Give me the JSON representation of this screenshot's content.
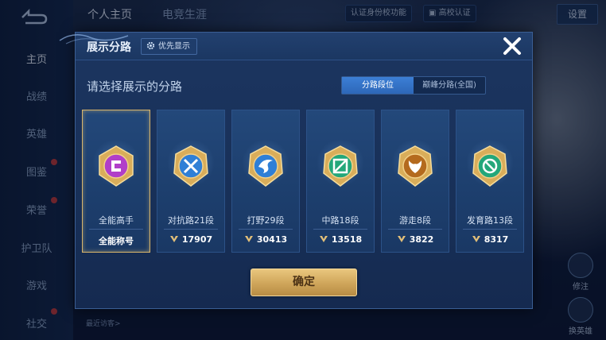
{
  "sidebar": {
    "items": [
      {
        "label": "主页",
        "active": true
      },
      {
        "label": "战绩"
      },
      {
        "label": "英雄"
      },
      {
        "label": "图鉴",
        "dot": true
      },
      {
        "label": "荣誉",
        "dot": true
      },
      {
        "label": "护卫队"
      },
      {
        "label": "游戏"
      },
      {
        "label": "社交",
        "dot": true
      }
    ]
  },
  "topbar": {
    "tabs": [
      {
        "label": "个人主页",
        "active": true
      },
      {
        "label": "电竞生涯"
      }
    ],
    "verify_label": "认证身份校功能",
    "campus_label": "高校认证",
    "settings_label": "设置"
  },
  "background": {
    "recent_visitors_label": "最近访客>",
    "right_buttons": [
      "修注",
      "换英雄"
    ]
  },
  "dialog": {
    "title": "展示分路",
    "priority_button": "优先显示",
    "subtitle": "请选择展示的分路",
    "segments": [
      {
        "label": "分路段位",
        "active": true
      },
      {
        "label": "巅峰分路(全国)",
        "active": false
      }
    ],
    "cards": [
      {
        "name": "全能高手",
        "stat": "全能称号",
        "badge": "all-round-badge-icon",
        "color": "#b13ec9",
        "selected": true
      },
      {
        "name": "对抗路21段",
        "stat": "17907",
        "badge": "clash-lane-badge-icon",
        "color": "#2f7fd6"
      },
      {
        "name": "打野29段",
        "stat": "30413",
        "badge": "jungle-badge-icon",
        "color": "#2f7fd6"
      },
      {
        "name": "中路18段",
        "stat": "13518",
        "badge": "mid-lane-badge-icon",
        "color": "#23a77a"
      },
      {
        "name": "游走8段",
        "stat": "3822",
        "badge": "roam-badge-icon",
        "color": "#b46a1e"
      },
      {
        "name": "发育路13段",
        "stat": "8317",
        "badge": "farm-lane-badge-icon",
        "color": "#23a77a"
      }
    ],
    "confirm_label": "确定"
  }
}
